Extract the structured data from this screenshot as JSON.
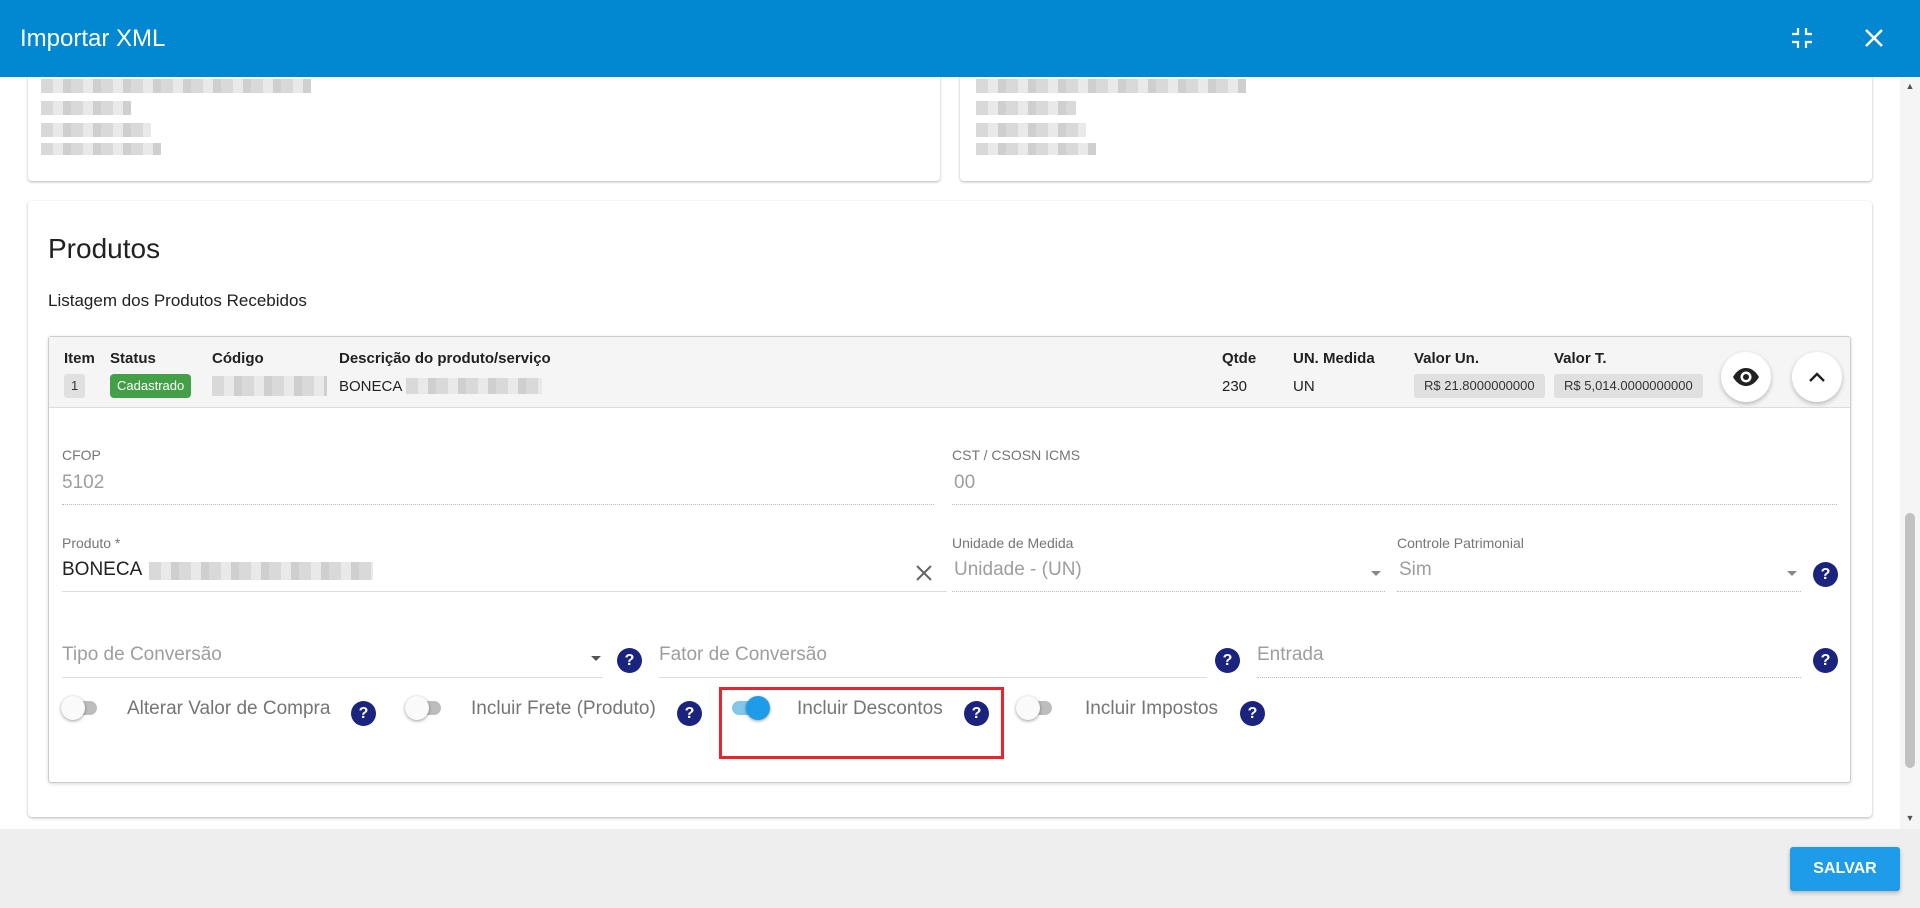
{
  "window": {
    "title": "Importar XML"
  },
  "section": {
    "title": "Produtos",
    "subtitle": "Listagem dos Produtos Recebidos"
  },
  "product_header": {
    "columns": {
      "item": "Item",
      "status": "Status",
      "codigo": "Código",
      "descricao": "Descrição do produto/serviço",
      "qtde": "Qtde",
      "un_medida": "UN. Medida",
      "valor_un": "Valor Un.",
      "valor_t": "Valor T."
    },
    "row": {
      "item": "1",
      "status": "Cadastrado",
      "descricao": "BONECA",
      "qtde": "230",
      "un_medida": "UN",
      "valor_un": "R$ 21.8000000000",
      "valor_t": "R$ 5,014.0000000000"
    }
  },
  "fields": {
    "cfop": {
      "label": "CFOP",
      "value": "5102"
    },
    "cst": {
      "label": "CST / CSOSN ICMS",
      "value": "00"
    },
    "produto": {
      "label": "Produto *",
      "value": "BONECA"
    },
    "unidade": {
      "label": "Unidade de Medida",
      "value": "Unidade - (UN)"
    },
    "controle": {
      "label": "Controle Patrimonial",
      "value": "Sim"
    },
    "tipo_conversao": {
      "placeholder": "Tipo de Conversão"
    },
    "fator_conversao": {
      "placeholder": "Fator de Conversão"
    },
    "entrada": {
      "placeholder": "Entrada"
    }
  },
  "toggles": [
    {
      "label": "Alterar Valor de Compra",
      "on": false
    },
    {
      "label": "Incluir Frete (Produto)",
      "on": false
    },
    {
      "label": "Incluir Descontos",
      "on": true
    },
    {
      "label": "Incluir Impostos",
      "on": false
    }
  ],
  "help_glyph": "?",
  "footer": {
    "save_label": "SALVAR"
  },
  "colors": {
    "primary": "#0288d1",
    "accent": "#1e9be9",
    "help": "#1a237e",
    "status_ok": "#43a047",
    "highlight": "#e8242c"
  }
}
